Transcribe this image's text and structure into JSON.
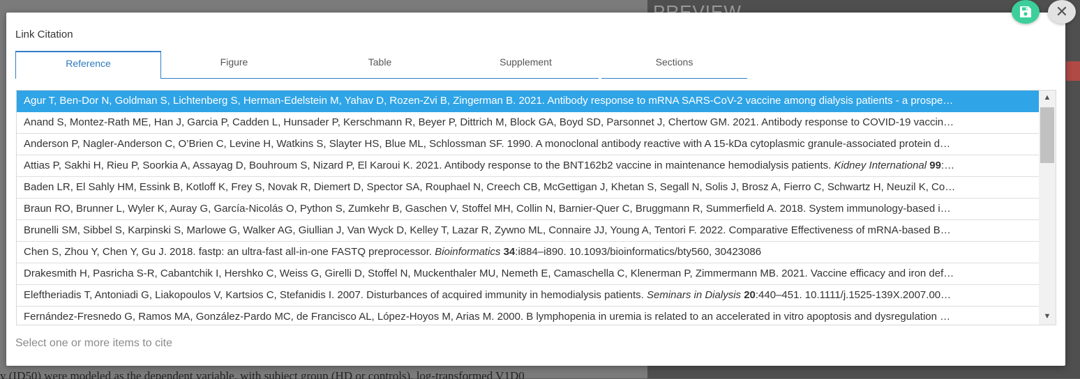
{
  "background": {
    "preview_label": "PREVIEW",
    "bottom_text": "y (ID50) were modeled as the dependent variable, with subject group (HD or controls), log-transformed V1D0"
  },
  "modal": {
    "title": "Link Citation",
    "tabs": [
      {
        "label": "Reference",
        "active": true
      },
      {
        "label": "Figure"
      },
      {
        "label": "Table"
      },
      {
        "label": "Supplement"
      },
      {
        "label": "Sections"
      }
    ],
    "hint": "Select one or more items to cite",
    "icons": {
      "save": "save-icon",
      "close": "close-icon",
      "scroll_up": "chevron-up-icon",
      "scroll_down": "chevron-down-icon"
    },
    "colors": {
      "accent": "#2fa4e7",
      "save": "#3ccf9c"
    }
  },
  "references": [
    {
      "text": "Agur T, Ben-Dor N, Goldman S, Lichtenberg S, Herman-Edelstein M, Yahav D, Rozen-Zvi B, Zingerman B. 2021. Antibody response to mRNA SARS-CoV-2 vaccine among dialysis patients - a prospe…",
      "selected": true
    },
    {
      "text": "Anand S, Montez-Rath ME, Han J, Garcia P, Cadden L, Hunsader P, Kerschmann R, Beyer P, Dittrich M, Block GA, Boyd SD, Parsonnet J, Chertow GM. 2021. Antibody response to COVID-19 vaccin…"
    },
    {
      "text": "Anderson P, Nagler-Anderson C, O’Brien C, Levine H, Watkins S, Slayter HS, Blue ML, Schlossman SF. 1990. A monoclonal antibody reactive with A 15-kDa cytoplasmic granule-associated protein d…"
    },
    {
      "text": "Attias P, Sakhi H, Rieu P, Soorkia A, Assayag D, Bouhroum S, Nizard P, El Karoui K. 2021. Antibody response to the BNT162b2 vaccine in maintenance hemodialysis patients. ",
      "journal": "Kidney International",
      "volume": "99",
      "rest": ":…"
    },
    {
      "text": "Baden LR, El Sahly HM, Essink B, Kotloff K, Frey S, Novak R, Diemert D, Spector SA, Rouphael N, Creech CB, McGettigan J, Khetan S, Segall N, Solis J, Brosz A, Fierro C, Schwartz H, Neuzil K, Co…"
    },
    {
      "text": "Braun RO, Brunner L, Wyler K, Auray G, García-Nicolás O, Python S, Zumkehr B, Gaschen V, Stoffel MH, Collin N, Barnier-Quer C, Bruggmann R, Summerfield A. 2018. System immunology-based i…"
    },
    {
      "text": "Brunelli SM, Sibbel S, Karpinski S, Marlowe G, Walker AG, Giullian J, Van Wyck D, Kelley T, Lazar R, Zywno ML, Connaire JJ, Young A, Tentori F. 2022. Comparative Effectiveness of mRNA-based B…"
    },
    {
      "text": "Chen S, Zhou Y, Chen Y, Gu J. 2018. fastp: an ultra-fast all-in-one FASTQ preprocessor. ",
      "journal": "Bioinformatics",
      "volume": "34",
      "rest": ":i884–i890. 10.1093/bioinformatics/bty560, 30423086"
    },
    {
      "text": "Drakesmith H, Pasricha S-R, Cabantchik I, Hershko C, Weiss G, Girelli D, Stoffel N, Muckenthaler MU, Nemeth E, Camaschella C, Klenerman P, Zimmermann MB. 2021. Vaccine efficacy and iron def…"
    },
    {
      "text": "Eleftheriadis T, Antoniadi G, Liakopoulos V, Kartsios C, Stefanidis I. 2007. Disturbances of acquired immunity in hemodialysis patients. ",
      "journal": "Seminars in Dialysis",
      "volume": "20",
      "rest": ":440–451. 10.1111/j.1525-139X.2007.00…"
    },
    {
      "text": "Fernández-Fresnedo G, Ramos MA, González-Pardo MC, de Francisco AL, López-Hoyos M, Arias M. 2000. B lymphopenia in uremia is related to an accelerated in vitro apoptosis and dysregulation …"
    }
  ]
}
